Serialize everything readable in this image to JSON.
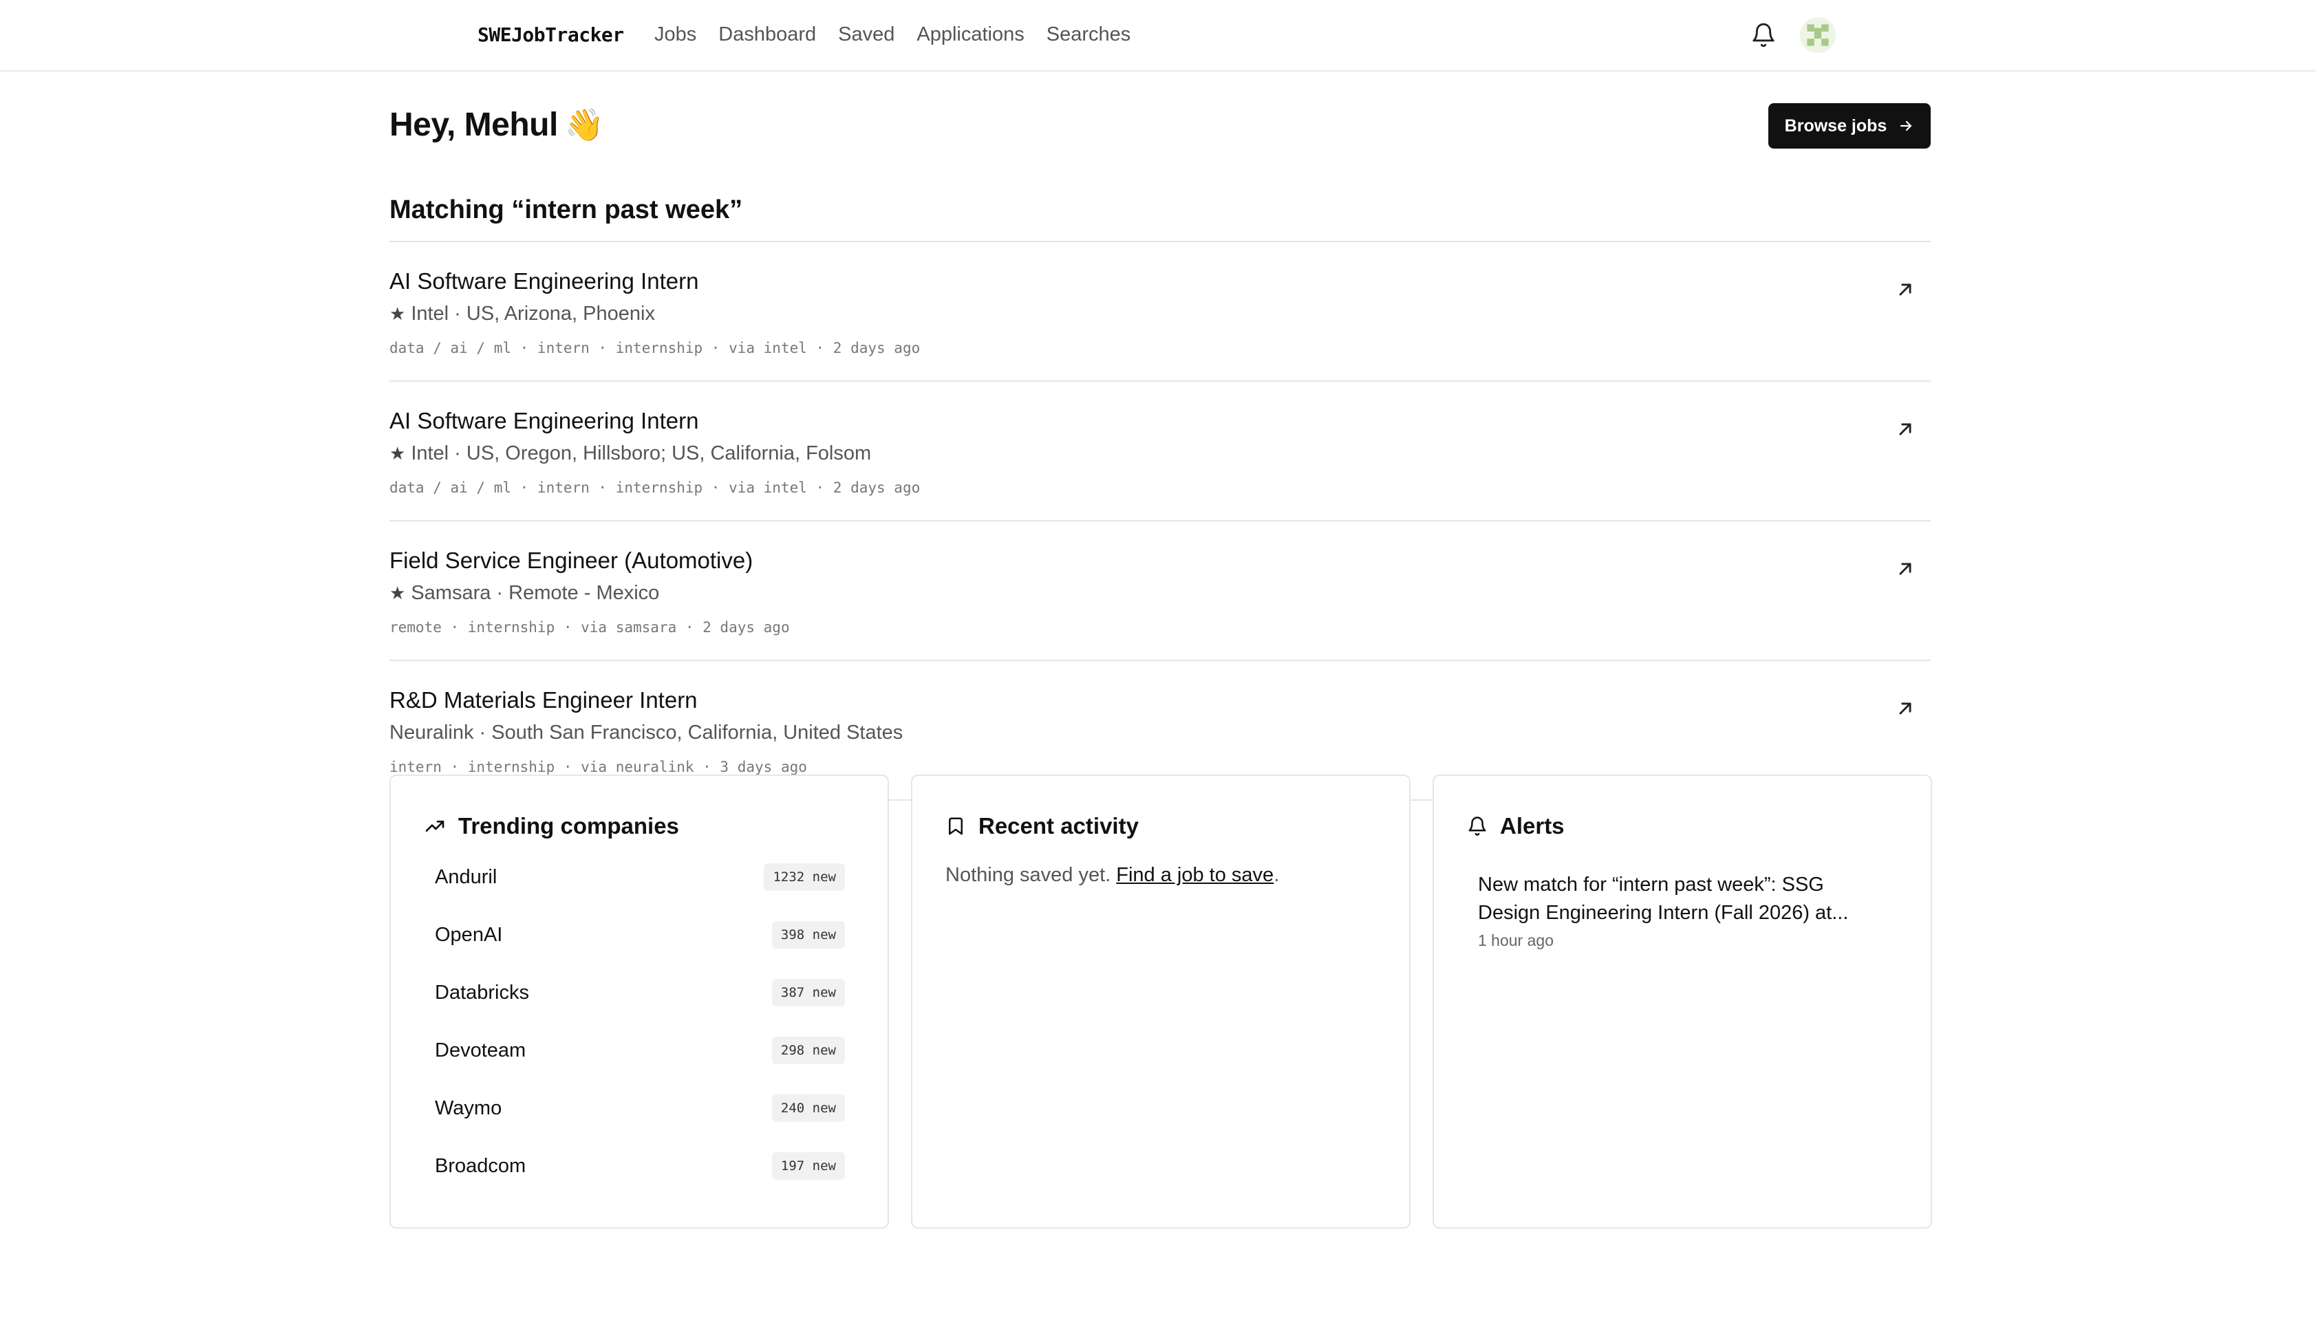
{
  "nav": {
    "brand": "SWEJobTracker",
    "links": [
      "Jobs",
      "Dashboard",
      "Saved",
      "Applications",
      "Searches"
    ]
  },
  "header": {
    "greeting": "Hey, Mehul",
    "wave": "👋",
    "browse_button": "Browse jobs"
  },
  "matching": {
    "title": "Matching “intern past week”",
    "jobs": [
      {
        "title": "AI Software Engineering Intern",
        "starred": true,
        "meta": "Intel · US, Arizona, Phoenix",
        "tags": "data / ai / ml · intern · internship · via intel · 2 days ago"
      },
      {
        "title": "AI Software Engineering Intern",
        "starred": true,
        "meta": "Intel · US, Oregon, Hillsboro; US, California, Folsom",
        "tags": "data / ai / ml · intern · internship · via intel · 2 days ago"
      },
      {
        "title": "Field Service Engineer (Automotive)",
        "starred": true,
        "meta": "Samsara · Remote - Mexico",
        "tags": "remote · internship · via samsara · 2 days ago"
      },
      {
        "title": "R&D Materials Engineer Intern",
        "starred": false,
        "meta": "Neuralink · South San Francisco, California, United States",
        "tags": "intern · internship · via neuralink · 3 days ago"
      }
    ]
  },
  "trending": {
    "title": "Trending companies",
    "companies": [
      {
        "name": "Anduril",
        "badge": "1232 new"
      },
      {
        "name": "OpenAI",
        "badge": "398 new"
      },
      {
        "name": "Databricks",
        "badge": "387 new"
      },
      {
        "name": "Devoteam",
        "badge": "298 new"
      },
      {
        "name": "Waymo",
        "badge": "240 new"
      },
      {
        "name": "Broadcom",
        "badge": "197 new"
      }
    ]
  },
  "recent": {
    "title": "Recent activity",
    "empty_text": "Nothing saved yet.",
    "empty_link": "Find a job to save",
    "empty_suffix": "."
  },
  "alerts": {
    "title": "Alerts",
    "items": [
      {
        "text": "New match for “intern past week”: SSG Design Engineering Intern (Fall 2026) at...",
        "time": "1 hour ago"
      }
    ]
  },
  "icons": {
    "bell": "bell-icon",
    "arrow_right": "arrow-right-icon",
    "external": "arrow-up-right-icon",
    "star": "star-icon",
    "trending": "trending-up-icon",
    "bookmark": "bookmark-icon"
  }
}
